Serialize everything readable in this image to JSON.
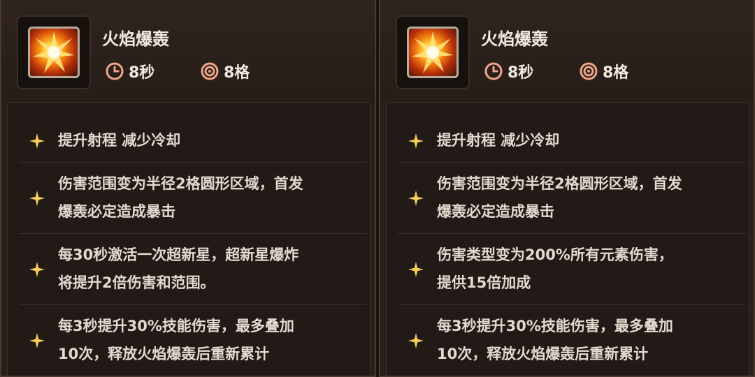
{
  "panels": [
    {
      "skill_name": "火焰爆轰",
      "cooldown": "8秒",
      "range": "8格",
      "items": [
        {
          "lines": [
            "提升射程 减少冷却"
          ]
        },
        {
          "lines": [
            "伤害范围变为半径2格圆形区域，首发",
            "爆轰必定造成暴击"
          ]
        },
        {
          "lines": [
            "每30秒激活一次超新星，超新星爆炸",
            "将提升2倍伤害和范围。"
          ]
        },
        {
          "lines": [
            "每3秒提升30%技能伤害，最多叠加",
            "10次，释放火焰爆轰后重新累计"
          ]
        }
      ]
    },
    {
      "skill_name": "火焰爆轰",
      "cooldown": "8秒",
      "range": "8格",
      "items": [
        {
          "lines": [
            "提升射程 减少冷却"
          ]
        },
        {
          "lines": [
            "伤害范围变为半径2格圆形区域，首发",
            "爆轰必定造成暴击"
          ]
        },
        {
          "lines": [
            "伤害类型变为200%所有元素伤害，",
            "提供15倍加成"
          ]
        },
        {
          "lines": [
            "每3秒提升30%技能伤害，最多叠加",
            "10次，释放火焰爆轰后重新累计"
          ]
        }
      ]
    }
  ],
  "colors": {
    "panel_bg": "#2a201b",
    "text": "#f2e9df",
    "accent_star": "#f5cf5a",
    "icon_ring": "#f0a58a"
  },
  "icons": {
    "skill": "fire-explosion-icon",
    "cooldown": "clock-icon",
    "range": "target-icon",
    "bullet": "sparkle-star-icon"
  }
}
